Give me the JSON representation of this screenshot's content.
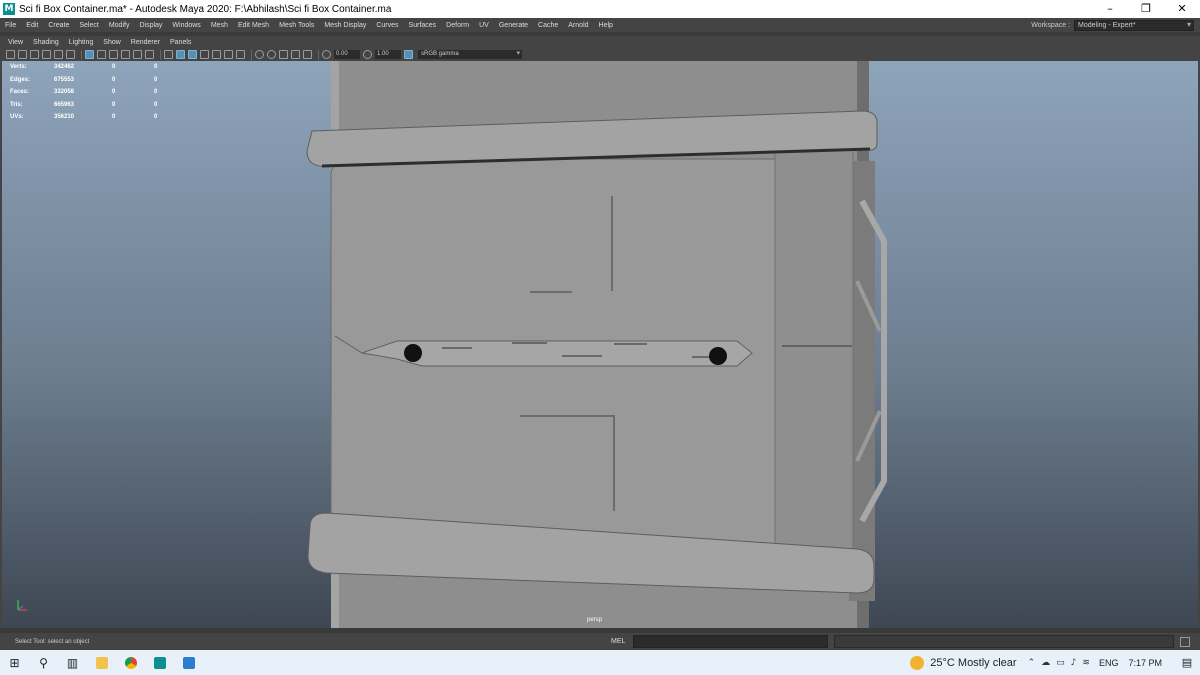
{
  "window": {
    "title": "Sci fi Box Container.ma* - Autodesk Maya 2020: F:\\Abhilash\\Sci fi Box Container.ma",
    "app_icon": "maya-icon",
    "controls": [
      "–",
      "❐",
      "✕"
    ]
  },
  "menubar": {
    "items": [
      "File",
      "Edit",
      "Create",
      "Select",
      "Modify",
      "Display",
      "Windows",
      "Mesh",
      "Edit Mesh",
      "Mesh Tools",
      "Mesh Display",
      "Curves",
      "Surfaces",
      "Deform",
      "UV",
      "Generate",
      "Cache",
      "Arnold",
      "Help"
    ],
    "workspace_label": "Workspace :",
    "workspace_value": "Modeling - Expert*"
  },
  "panel_menu": {
    "items": [
      "View",
      "Shading",
      "Lighting",
      "Show",
      "Renderer",
      "Panels"
    ]
  },
  "toolbar": {
    "exposure": "0.00",
    "gamma": "1.00",
    "color_space": "sRGB gamma"
  },
  "hud": {
    "rows": [
      {
        "label": "Verts:",
        "values": [
          "342462",
          "0",
          "0"
        ]
      },
      {
        "label": "Edges:",
        "values": [
          "675553",
          "0",
          "0"
        ]
      },
      {
        "label": "Faces:",
        "values": [
          "332058",
          "0",
          "0"
        ]
      },
      {
        "label": "Tris:",
        "values": [
          "665963",
          "0",
          "0"
        ]
      },
      {
        "label": "UVs:",
        "values": [
          "356210",
          "0",
          "0"
        ]
      }
    ]
  },
  "viewport": {
    "camera_label": "persp",
    "background_top": "#8ea4bb",
    "background_bottom": "#3e4753"
  },
  "helpline": {
    "text": "Select Tool: select an object",
    "mel_label": "MEL"
  },
  "taskbar": {
    "weather": "25°C  Mostly clear",
    "language": "ENG",
    "time": "7:17 PM",
    "apps": [
      "start-icon",
      "search-icon",
      "task-view-icon",
      "file-explorer-icon",
      "chrome-icon",
      "maya-icon",
      "photos-icon"
    ]
  }
}
